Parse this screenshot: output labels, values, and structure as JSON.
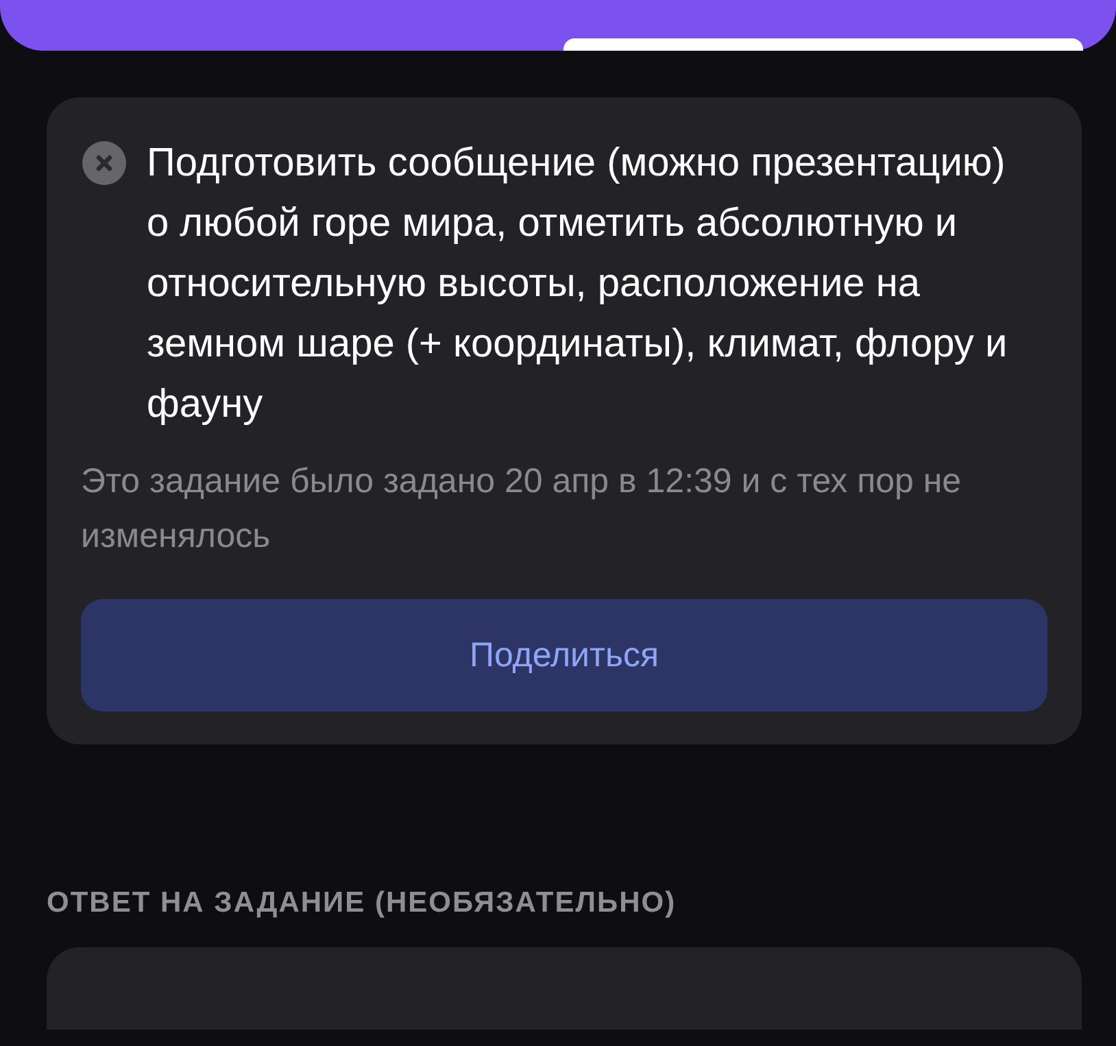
{
  "task": {
    "text": "Подготовить сообщение (можно презентацию) о любой горе мира, отметить абсолютную и относительную высоты, расположение на земном шаре (+ координаты), климат, флору и фауну",
    "meta": "Это задание было задано 20 апр в 12:39 и с тех пор не изменялось",
    "share_button": "Поделиться"
  },
  "answer_section": {
    "title": "ОТВЕТ НА ЗАДАНИЕ (НЕОБЯЗАТЕЛЬНО)"
  }
}
